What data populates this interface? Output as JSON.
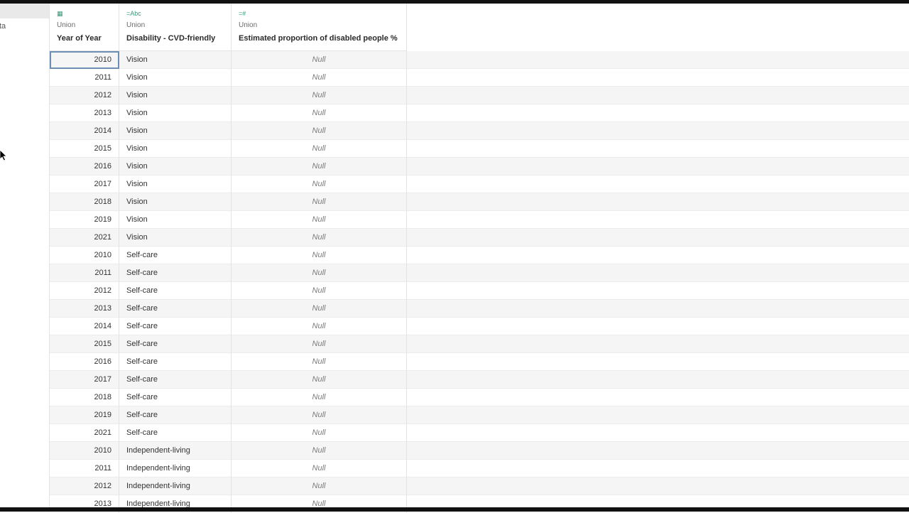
{
  "left_panel": {
    "clipped_text": "ta"
  },
  "columns": [
    {
      "type_icon": "calendar-icon",
      "type_glyph": "▦",
      "source": "Union",
      "name": "Year of Year"
    },
    {
      "type_icon": "string-type-icon",
      "type_glyph": "=Abc",
      "source": "Union",
      "name": "Disability - CVD-friendly"
    },
    {
      "type_icon": "number-type-icon",
      "type_glyph": "=#",
      "source": "Union",
      "name": "Estimated proportion of disabled people %"
    }
  ],
  "rows": [
    {
      "year": "2010",
      "disability": "Vision",
      "estimate": "Null"
    },
    {
      "year": "2011",
      "disability": "Vision",
      "estimate": "Null"
    },
    {
      "year": "2012",
      "disability": "Vision",
      "estimate": "Null"
    },
    {
      "year": "2013",
      "disability": "Vision",
      "estimate": "Null"
    },
    {
      "year": "2014",
      "disability": "Vision",
      "estimate": "Null"
    },
    {
      "year": "2015",
      "disability": "Vision",
      "estimate": "Null"
    },
    {
      "year": "2016",
      "disability": "Vision",
      "estimate": "Null"
    },
    {
      "year": "2017",
      "disability": "Vision",
      "estimate": "Null"
    },
    {
      "year": "2018",
      "disability": "Vision",
      "estimate": "Null"
    },
    {
      "year": "2019",
      "disability": "Vision",
      "estimate": "Null"
    },
    {
      "year": "2021",
      "disability": "Vision",
      "estimate": "Null"
    },
    {
      "year": "2010",
      "disability": "Self-care",
      "estimate": "Null"
    },
    {
      "year": "2011",
      "disability": "Self-care",
      "estimate": "Null"
    },
    {
      "year": "2012",
      "disability": "Self-care",
      "estimate": "Null"
    },
    {
      "year": "2013",
      "disability": "Self-care",
      "estimate": "Null"
    },
    {
      "year": "2014",
      "disability": "Self-care",
      "estimate": "Null"
    },
    {
      "year": "2015",
      "disability": "Self-care",
      "estimate": "Null"
    },
    {
      "year": "2016",
      "disability": "Self-care",
      "estimate": "Null"
    },
    {
      "year": "2017",
      "disability": "Self-care",
      "estimate": "Null"
    },
    {
      "year": "2018",
      "disability": "Self-care",
      "estimate": "Null"
    },
    {
      "year": "2019",
      "disability": "Self-care",
      "estimate": "Null"
    },
    {
      "year": "2021",
      "disability": "Self-care",
      "estimate": "Null"
    },
    {
      "year": "2010",
      "disability": "Independent-living",
      "estimate": "Null"
    },
    {
      "year": "2011",
      "disability": "Independent-living",
      "estimate": "Null"
    },
    {
      "year": "2012",
      "disability": "Independent-living",
      "estimate": "Null"
    },
    {
      "year": "2013",
      "disability": "Independent-living",
      "estimate": "Null"
    }
  ],
  "colors": {
    "type_icon": "#3a9a78",
    "selection_outline": "#6e8fb5",
    "alt_row": "#f5f5f5"
  }
}
